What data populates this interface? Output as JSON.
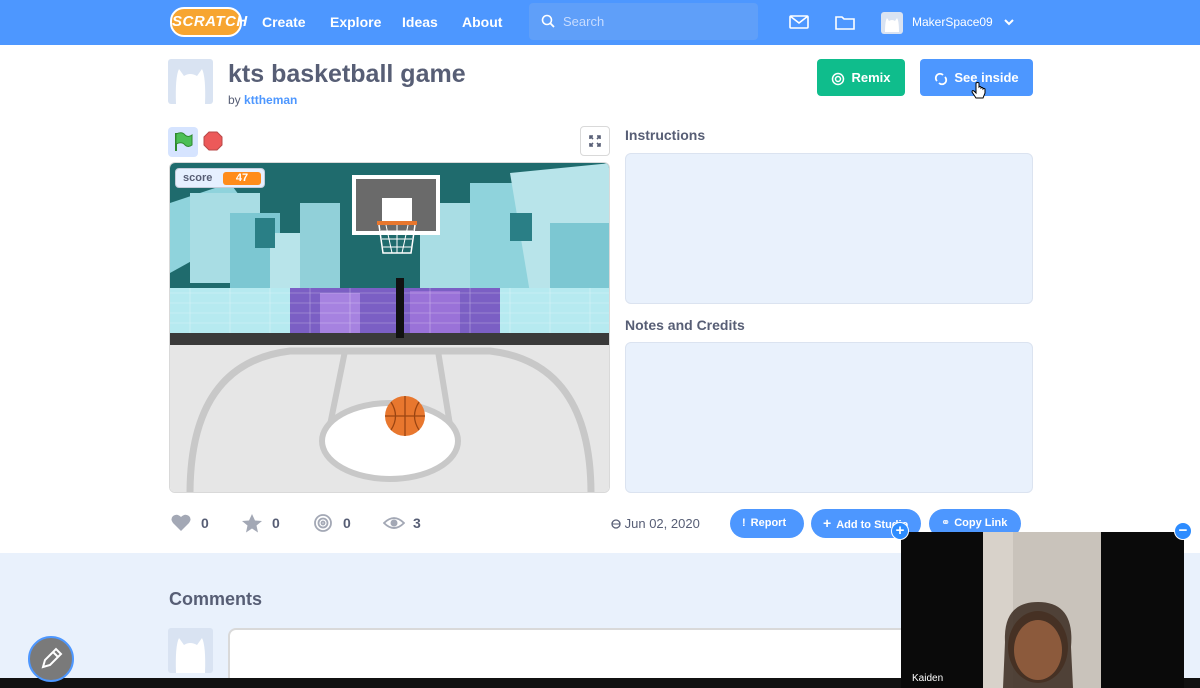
{
  "nav": {
    "logo": "SCRATCH",
    "links": [
      "Create",
      "Explore",
      "Ideas",
      "About"
    ],
    "search_placeholder": "Search",
    "username": "MakerSpace09"
  },
  "project": {
    "title": "kts basketball game",
    "by_prefix": "by",
    "author": "kttheman",
    "remix_label": "Remix",
    "see_inside_label": "See inside"
  },
  "stage": {
    "monitor_label": "score",
    "monitor_value": "47"
  },
  "sections": {
    "instructions": "Instructions",
    "notes": "Notes and Credits"
  },
  "stats": {
    "loves": "0",
    "favorites": "0",
    "remixes": "0",
    "views": "3",
    "date": "Jun 02, 2020"
  },
  "actions": {
    "report": "Report",
    "add_to_studio": "Add to Studio",
    "copy_link": "Copy Link"
  },
  "comments": {
    "title": "Comments"
  },
  "video": {
    "participant": "Kaiden"
  },
  "colors": {
    "nav": "#4d97ff",
    "remix": "#0fbd8c",
    "accent": "#4d97ff",
    "score_monitor": "#ff8c1a"
  }
}
